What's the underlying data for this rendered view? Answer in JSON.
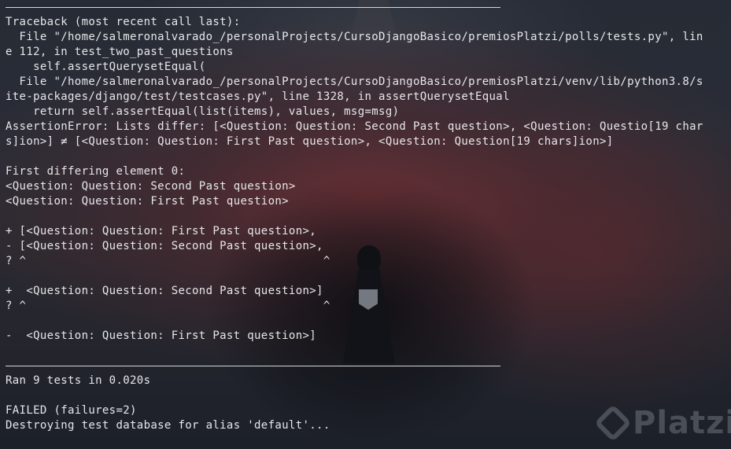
{
  "terminal": {
    "lines": [
      "Traceback (most recent call last):",
      "  File \"/home/salmeronalvarado_/personalProjects/CursoDjangoBasico/premiosPlatzi/polls/tests.py\", lin",
      "e 112, in test_two_past_questions",
      "    self.assertQuerysetEqual(",
      "  File \"/home/salmeronalvarado_/personalProjects/CursoDjangoBasico/premiosPlatzi/venv/lib/python3.8/s",
      "ite-packages/django/test/testcases.py\", line 1328, in assertQuerysetEqual",
      "    return self.assertEqual(list(items), values, msg=msg)",
      "AssertionError: Lists differ: [<Question: Question: Second Past question>, <Question: Questio[19 char",
      "s]ion>] ≠ [<Question: Question: First Past question>, <Question: Question[19 chars]ion>]",
      "",
      "First differing element 0:",
      "<Question: Question: Second Past question>",
      "<Question: Question: First Past question>",
      "",
      "+ [<Question: Question: First Past question>,",
      "- [<Question: Question: Second Past question>,",
      "? ^                                           ^",
      "",
      "+  <Question: Question: Second Past question>]",
      "? ^                                           ^",
      "",
      "-  <Question: Question: First Past question>]",
      "",
      "",
      "Ran 9 tests in 0.020s",
      "",
      "FAILED (failures=2)",
      "Destroying test database for alias 'default'..."
    ]
  },
  "watermark": {
    "brand": "Platzi",
    "icon": "platzi-logo-icon"
  },
  "colors": {
    "text": "#e6e7ea",
    "background": "#1f2531",
    "rule": "#d4d6da",
    "accent_red": "#963234"
  }
}
